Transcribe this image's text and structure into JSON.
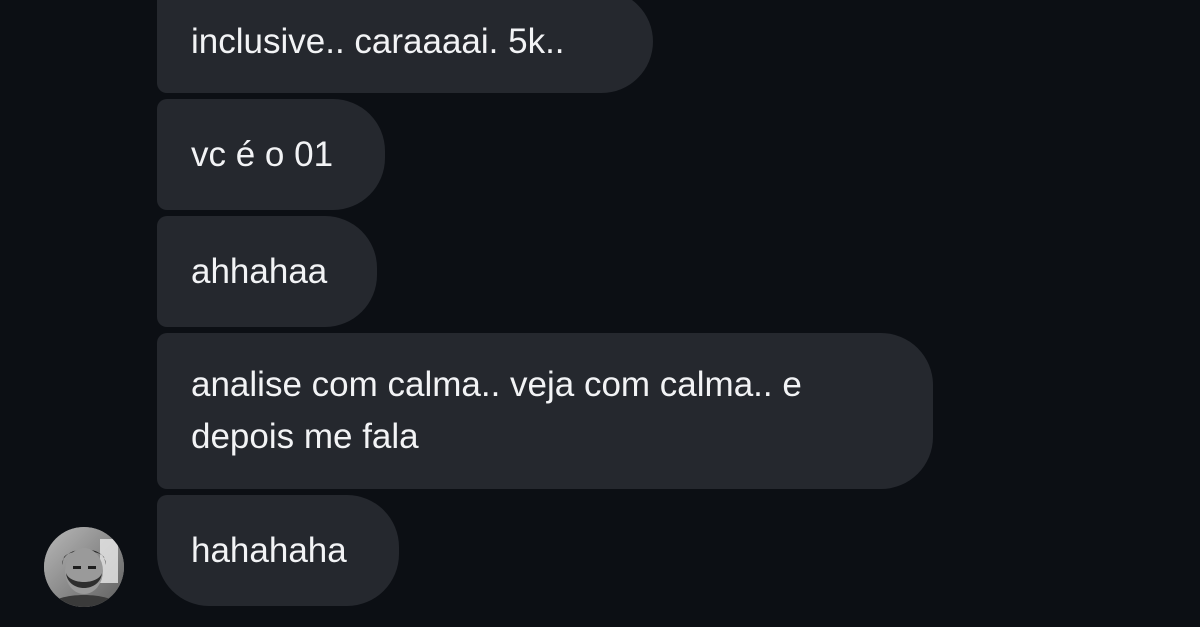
{
  "messages": [
    {
      "text": "inclusive.. caraaaai. 5k.."
    },
    {
      "text": "vc é o 01"
    },
    {
      "text": "ahhahaa"
    },
    {
      "text": "analise com calma.. veja com calma.. e\ndepois me fala"
    },
    {
      "text": "hahahaha"
    }
  ],
  "colors": {
    "background": "#0c0f14",
    "bubble": "#25282e",
    "text": "#f2f3f5"
  },
  "icons": {
    "avatar": "sender-avatar-icon"
  }
}
